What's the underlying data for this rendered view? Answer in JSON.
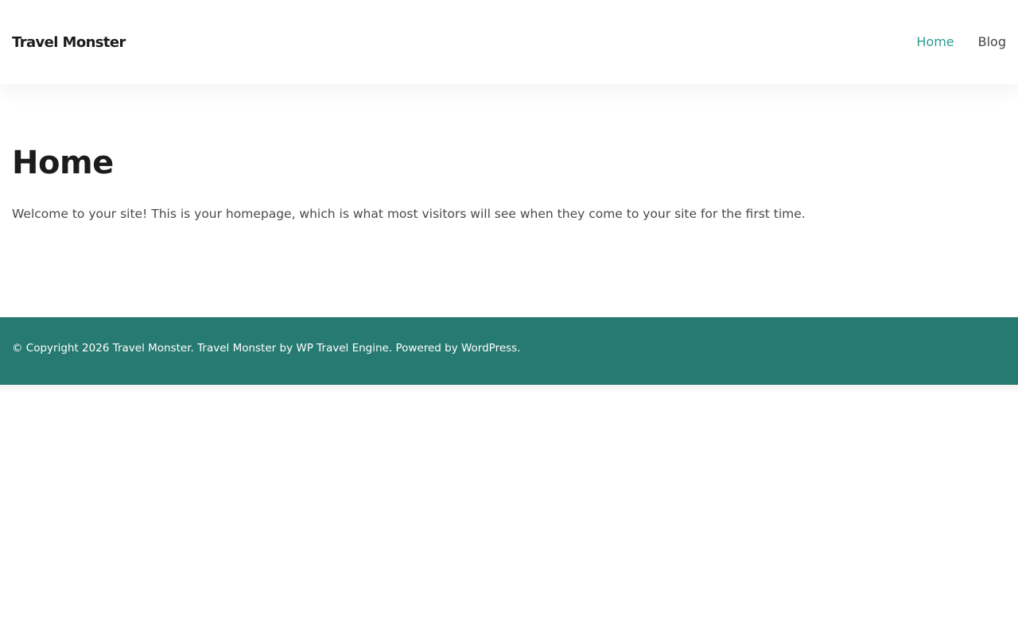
{
  "header": {
    "site_title": "Travel Monster",
    "nav": [
      {
        "label": "Home",
        "current": true
      },
      {
        "label": "Blog",
        "current": false
      }
    ]
  },
  "main": {
    "title": "Home",
    "intro": "Welcome to your site! This is your homepage, which is what most visitors will see when they come to your site for the first time."
  },
  "footer": {
    "copyright_prefix": "© Copyright 2026 ",
    "site_link": "Travel Monster",
    "sep1": ". ",
    "theme_link": "Travel Monster",
    "by": " by ",
    "author_link": "WP Travel Engine",
    "powered": ". Powered by ",
    "platform_link": "WordPress",
    "end": "."
  },
  "colors": {
    "accent": "#2c9d8e",
    "footer_bg": "#277a71",
    "heading": "#1c1c1c",
    "body_text": "#4a4a4a"
  }
}
